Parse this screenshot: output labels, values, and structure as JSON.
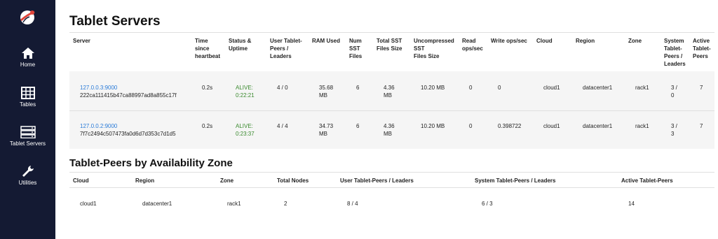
{
  "sidebar": {
    "items": [
      {
        "label": "Home",
        "icon": "home-icon"
      },
      {
        "label": "Tables",
        "icon": "tables-icon"
      },
      {
        "label": "Tablet Servers",
        "icon": "servers-icon"
      },
      {
        "label": "Utilities",
        "icon": "wrench-icon"
      }
    ]
  },
  "servers_section": {
    "title": "Tablet Servers",
    "headers": {
      "server": "Server",
      "heartbeat": [
        "Time",
        "since",
        "heartbeat"
      ],
      "status": [
        "Status &",
        "Uptime"
      ],
      "user_peers": [
        "User Tablet-",
        "Peers /",
        "Leaders"
      ],
      "ram": "RAM Used",
      "num_sst": [
        "Num",
        "SST",
        "Files"
      ],
      "total_sst": [
        "Total SST",
        "Files Size"
      ],
      "uncompressed": [
        "Uncompressed",
        "SST",
        "Files Size"
      ],
      "read_ops": [
        "Read",
        "ops/sec"
      ],
      "write_ops": "Write ops/sec",
      "cloud": "Cloud",
      "region": "Region",
      "zone": "Zone",
      "system_peers": [
        "System",
        "Tablet-",
        "Peers /",
        "Leaders"
      ],
      "active_peers": [
        "Active",
        "Tablet-",
        "Peers"
      ]
    },
    "rows": [
      {
        "server_link": "127.0.0.3:9000",
        "server_uuid": "222ca111415b47ca88997ad8a855c17f",
        "heartbeat": "0.2s",
        "status": [
          "ALIVE:",
          "0:22:21"
        ],
        "user_peers": "4 / 0",
        "ram": [
          "35.68",
          "MB"
        ],
        "num_sst": "6",
        "total_sst": [
          "4.36",
          "MB"
        ],
        "uncompressed": "10.20 MB",
        "read_ops": "0",
        "write_ops": "0",
        "cloud": "cloud1",
        "region": "datacenter1",
        "zone": "rack1",
        "system_peers": [
          "3 /",
          "0"
        ],
        "active_peers": "7"
      },
      {
        "server_link": "127.0.0.2:9000",
        "server_uuid": "7f7c2494c507473fa0d6d7d353c7d1d5",
        "heartbeat": "0.2s",
        "status": [
          "ALIVE:",
          "0:23:37"
        ],
        "user_peers": "4 / 4",
        "ram": [
          "34.73",
          "MB"
        ],
        "num_sst": "6",
        "total_sst": [
          "4.36",
          "MB"
        ],
        "uncompressed": "10.20 MB",
        "read_ops": "0",
        "write_ops": "0.398722",
        "cloud": "cloud1",
        "region": "datacenter1",
        "zone": "rack1",
        "system_peers": [
          "3 /",
          "3"
        ],
        "active_peers": "7"
      }
    ]
  },
  "zones_section": {
    "title": "Tablet-Peers by Availability Zone",
    "headers": {
      "cloud": "Cloud",
      "region": "Region",
      "zone": "Zone",
      "total_nodes": "Total Nodes",
      "user_peers": "User Tablet-Peers / Leaders",
      "system_peers": "System Tablet-Peers / Leaders",
      "active_peers": "Active Tablet-Peers"
    },
    "rows": [
      {
        "cloud": "cloud1",
        "region": "datacenter1",
        "zone": "rack1",
        "total_nodes": "2",
        "user_peers": "8 / 4",
        "system_peers": "6 / 3",
        "active_peers": "14"
      }
    ]
  },
  "colors": {
    "sidebar": "#141a33",
    "link": "#2a7bd8",
    "alive": "#3a8a2e"
  }
}
